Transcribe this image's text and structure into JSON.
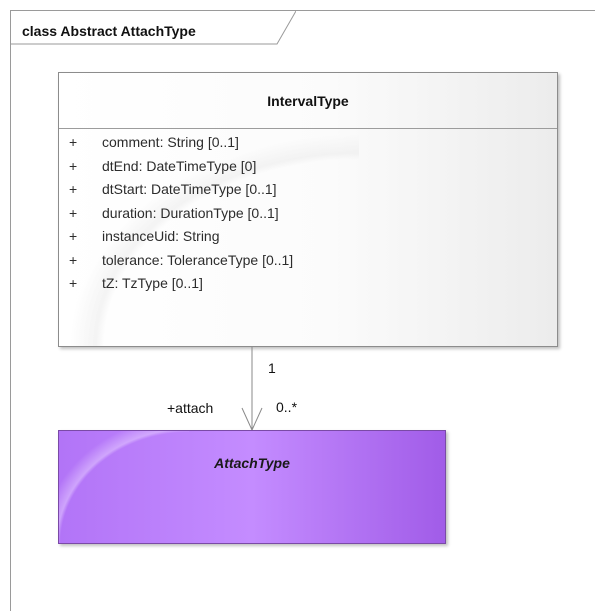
{
  "frame": {
    "title": "class Abstract AttachType"
  },
  "interval_class": {
    "name": "IntervalType",
    "attributes": [
      {
        "visibility": "+",
        "text": "comment: String [0..1]"
      },
      {
        "visibility": "+",
        "text": "dtEnd: DateTimeType [0]"
      },
      {
        "visibility": "+",
        "text": "dtStart: DateTimeType [0..1]"
      },
      {
        "visibility": "+",
        "text": "duration: DurationType [0..1]"
      },
      {
        "visibility": "+",
        "text": "instanceUid: String"
      },
      {
        "visibility": "+",
        "text": "tolerance: ToleranceType [0..1]"
      },
      {
        "visibility": "+",
        "text": "tZ: TzType [0..1]"
      }
    ]
  },
  "association": {
    "source_multiplicity": "1",
    "target_role": "+attach",
    "target_multiplicity": "0..*"
  },
  "attach_class": {
    "name": "AttachType",
    "abstract": true
  },
  "colors": {
    "abstract_fill": "#b274f7",
    "class_fill": "#ffffff",
    "border": "#8c8c8c"
  }
}
